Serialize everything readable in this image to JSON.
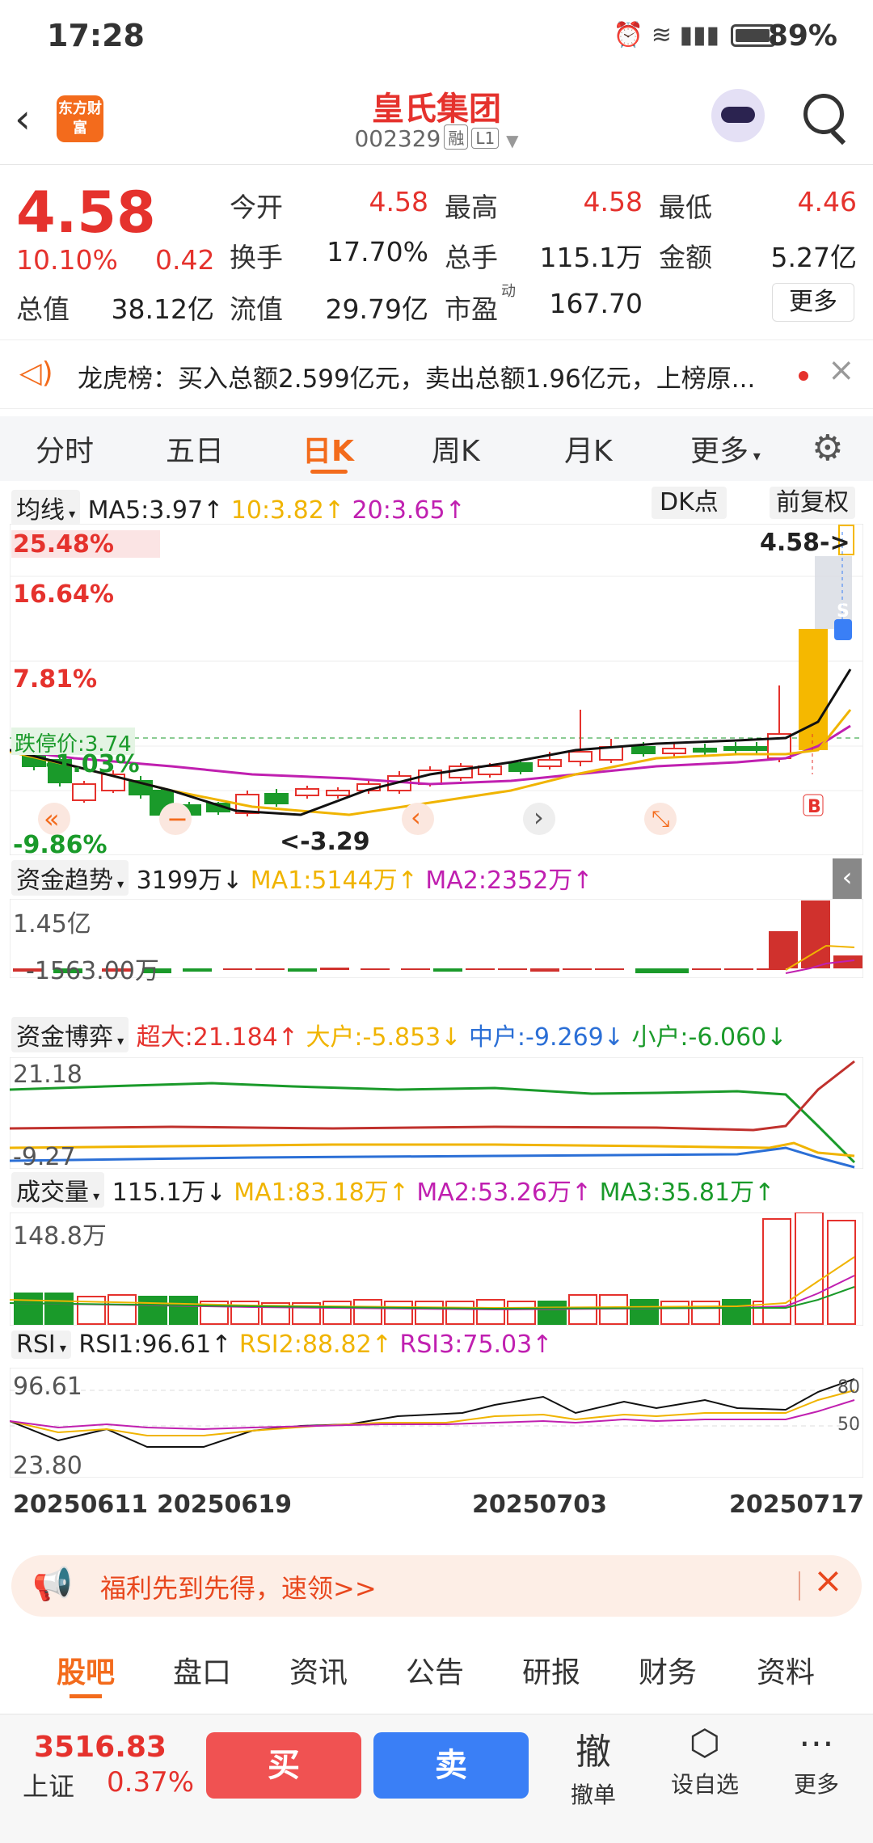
{
  "status_bar": {
    "time": "17:28",
    "battery": "89%"
  },
  "header": {
    "logo_text": "东方财富",
    "stock_name": "皇氏集团",
    "stock_code": "002329",
    "tag_margin": "融",
    "tag_level": "L1"
  },
  "quote": {
    "price": "4.58",
    "change_pct": "10.10%",
    "change_abs": "0.42",
    "row1": [
      {
        "label": "今开",
        "value": "4.58"
      },
      {
        "label": "最高",
        "value": "4.58"
      },
      {
        "label": "最低",
        "value": "4.46"
      }
    ],
    "row2": [
      {
        "label": "换手",
        "value": "17.70%"
      },
      {
        "label": "总手",
        "value": "115.1万"
      },
      {
        "label": "金额",
        "value": "5.27亿"
      }
    ],
    "row3": [
      {
        "label": "总值",
        "value": "38.12亿"
      },
      {
        "label": "流值",
        "value": "29.79亿"
      },
      {
        "label": "市盈",
        "value": "167.70"
      }
    ],
    "pe_sup": "动",
    "more_label": "更多"
  },
  "notice": {
    "text": "龙虎榜：买入总额2.599亿元，卖出总额1.96亿元，上榜原..."
  },
  "tabs": [
    "分时",
    "五日",
    "日K",
    "周K",
    "月K",
    "更多"
  ],
  "chart_controls": {
    "ma_dropdown": "均线",
    "ma5": "MA5:3.97↑",
    "ma10": "10:3.82↑",
    "ma20": "20:3.65↑",
    "dk_button": "DK点",
    "adjust_button": "前复权"
  },
  "kline": {
    "y_labels": [
      "25.48%",
      "16.64%",
      "7.81%",
      "-1.03%",
      "-9.86%"
    ],
    "limit_down_label": "跌停价:3.74",
    "last_price_label": "4.58->",
    "low_label": "<-3.29",
    "s_marker": "S",
    "b_marker": "B"
  },
  "capital_trend": {
    "name": "资金趋势",
    "value": "3199万↓",
    "ma1": "MA1:5144万↑",
    "ma2": "MA2:2352万↑",
    "top": "1.45亿",
    "bottom": "-1563.00万"
  },
  "capital_game": {
    "name": "资金博弈",
    "super": "超大:21.184↑",
    "large": "大户:-5.853↓",
    "mid": "中户:-9.269↓",
    "small": "小户:-6.060↓",
    "top": "21.18",
    "bottom": "-9.27"
  },
  "volume": {
    "name": "成交量",
    "value": "115.1万↓",
    "ma1": "MA1:83.18万↑",
    "ma2": "MA2:53.26万↑",
    "ma3": "MA3:35.81万↑",
    "top": "148.8万"
  },
  "rsi": {
    "name": "RSI",
    "rsi1": "RSI1:96.61↑",
    "rsi2": "RSI2:88.82↑",
    "rsi3": "RSI3:75.03↑",
    "top": "96.61",
    "bottom": "23.80",
    "ref80": "80",
    "ref50": "50"
  },
  "dates": [
    "20250611",
    "20250619",
    "20250703",
    "20250717"
  ],
  "promo": {
    "text": "福利先到先得，速领>>"
  },
  "bottom_tabs": [
    "股吧",
    "盘口",
    "资讯",
    "公告",
    "研报",
    "财务",
    "资料"
  ],
  "bottom_bar": {
    "index_value": "3516.83",
    "index_name": "上证",
    "index_change": "0.37%",
    "buy": "买",
    "sell": "卖",
    "withdraw_icon": "撤",
    "withdraw": "撤单",
    "watchlist": "设自选",
    "more": "更多"
  },
  "colors": {
    "up": "#e5322d",
    "down": "#1a9a2a",
    "accent": "#f36b1c",
    "ma10": "#f0b400",
    "ma20": "#c020b0"
  }
}
